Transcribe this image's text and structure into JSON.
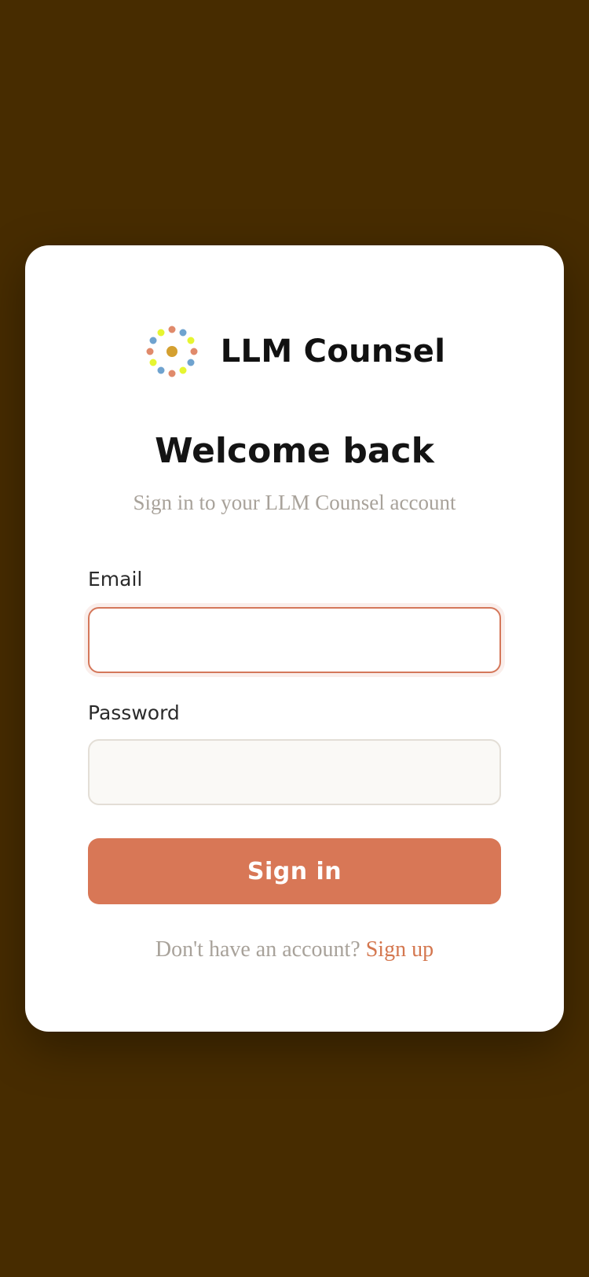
{
  "brand": {
    "name": "LLM Counsel",
    "logo_icon": "dotted-circle-logo",
    "logo_colors": [
      "#e08a6b",
      "#e6f531",
      "#6fa3cf",
      "#d4a030"
    ]
  },
  "heading": {
    "title": "Welcome back",
    "subtitle": "Sign in to your LLM Counsel account"
  },
  "form": {
    "email_label": "Email",
    "email_value": "",
    "email_placeholder": "",
    "password_label": "Password",
    "password_value": "",
    "password_placeholder": "",
    "submit_label": "Sign in"
  },
  "footer": {
    "prompt": "Don't have an account?",
    "signup_label": "Sign up"
  },
  "colors": {
    "background": "#472c00",
    "accent": "#d87756",
    "card": "#ffffff"
  }
}
